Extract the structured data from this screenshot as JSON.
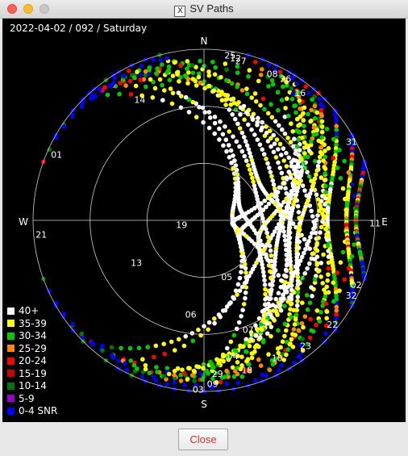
{
  "window": {
    "title": "SV Paths"
  },
  "plot": {
    "date_label": "2022-04-02 / 092 / Saturday",
    "compass": {
      "north": "N",
      "south": "S",
      "east": "E",
      "west": "W"
    },
    "satellites": [
      {
        "id": "25",
        "az": 9,
        "el": 2
      },
      {
        "id": "12",
        "az": 11,
        "el": 3
      },
      {
        "id": "27",
        "az": 13,
        "el": 4
      },
      {
        "id": "08",
        "az": 25,
        "el": 5
      },
      {
        "id": "26",
        "az": 30,
        "el": 4
      },
      {
        "id": "16",
        "az": 37,
        "el": 6
      },
      {
        "id": "31",
        "az": 62,
        "el": 2
      },
      {
        "id": "11",
        "az": 91,
        "el": 0
      },
      {
        "id": "02",
        "az": 113,
        "el": 3
      },
      {
        "id": "32",
        "az": 117,
        "el": 3
      },
      {
        "id": "22",
        "az": 129,
        "el": 3
      },
      {
        "id": "23",
        "az": 141,
        "el": 5
      },
      {
        "id": "10",
        "az": 152,
        "el": 8
      },
      {
        "id": "18",
        "az": 164,
        "el": 8
      },
      {
        "id": "04",
        "az": 168,
        "el": 17
      },
      {
        "id": "29",
        "az": 175,
        "el": 9
      },
      {
        "id": "09",
        "az": 177,
        "el": 4
      },
      {
        "id": "03",
        "az": 182,
        "el": 1
      },
      {
        "id": "07",
        "az": 158,
        "el": 28
      },
      {
        "id": "06",
        "az": 188,
        "el": 40
      },
      {
        "id": "05",
        "az": 158,
        "el": 58
      },
      {
        "id": "13",
        "az": 238,
        "el": 48
      },
      {
        "id": "19",
        "az": 259,
        "el": 78
      },
      {
        "id": "21",
        "az": 265,
        "el": 4
      },
      {
        "id": "01",
        "az": 294,
        "el": 5
      },
      {
        "id": "14",
        "az": 332,
        "el": 18
      }
    ]
  },
  "legend": [
    {
      "label": "40+",
      "color": "#ffffff"
    },
    {
      "label": "35-39",
      "color": "#ffff00"
    },
    {
      "label": "30-34",
      "color": "#00cc00"
    },
    {
      "label": "25-29",
      "color": "#ff8800"
    },
    {
      "label": "20-24",
      "color": "#ff0000"
    },
    {
      "label": "15-19",
      "color": "#cc0000"
    },
    {
      "label": "10-14",
      "color": "#007700"
    },
    {
      "label": "5-9",
      "color": "#9900cc"
    },
    {
      "label": "0-4 SNR",
      "color": "#0000ff"
    }
  ],
  "footer": {
    "close_label": "Close"
  }
}
